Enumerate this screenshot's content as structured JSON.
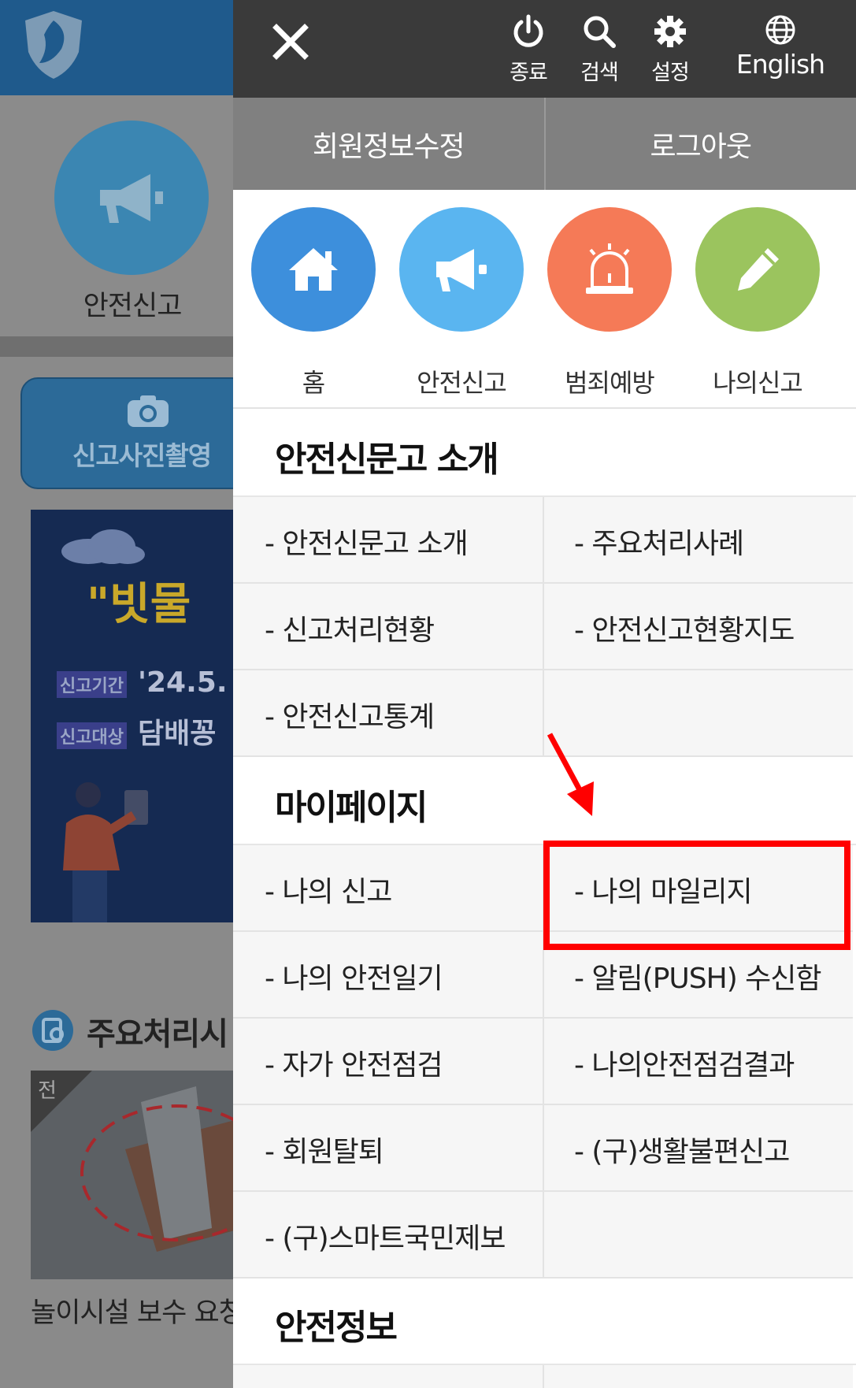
{
  "background": {
    "main_icon_label": "안전신고",
    "photo_button_label": "신고사진촬영",
    "banner": {
      "title": "\"빗물",
      "row1_label": "신고기간",
      "row1_value": "'24.5.",
      "row2_label": "신고대상",
      "row2_value": "담배꽁"
    },
    "section_title": "주요처리시",
    "thumb_tag": "전",
    "thumb_caption": "놀이시설 보수 요청"
  },
  "drawer": {
    "toolbar": {
      "close_label": "닫기",
      "exit_label": "종료",
      "search_label": "검색",
      "settings_label": "설정",
      "english_label": "English"
    },
    "account": {
      "edit_profile_label": "회원정보수정",
      "logout_label": "로그아웃"
    },
    "quick_menu": [
      {
        "label": "홈",
        "icon": "home-icon",
        "color": "#3d8fdc"
      },
      {
        "label": "안전신고",
        "icon": "megaphone-icon",
        "color": "#5ab5f0"
      },
      {
        "label": "범죄예방",
        "icon": "siren-icon",
        "color": "#f57a57"
      },
      {
        "label": "나의신고",
        "icon": "pencil-icon",
        "color": "#9bc45e"
      }
    ],
    "sections": {
      "intro": {
        "title": "안전신문고 소개",
        "items": [
          "- 안전신문고 소개",
          "- 주요처리사례",
          "- 신고처리현황",
          "- 안전신고현황지도",
          "- 안전신고통계"
        ]
      },
      "mypage": {
        "title": "마이페이지",
        "items": [
          "- 나의 신고",
          "- 나의 마일리지",
          "- 나의 안전일기",
          "- 알림(PUSH) 수신함",
          "- 자가 안전점검",
          "- 나의안전점검결과",
          "- 회원탈퇴",
          "- (구)생활불편신고",
          "- (구)스마트국민제보"
        ]
      },
      "safety": {
        "title": "안전정보"
      }
    },
    "highlight_color": "#ff0000"
  }
}
